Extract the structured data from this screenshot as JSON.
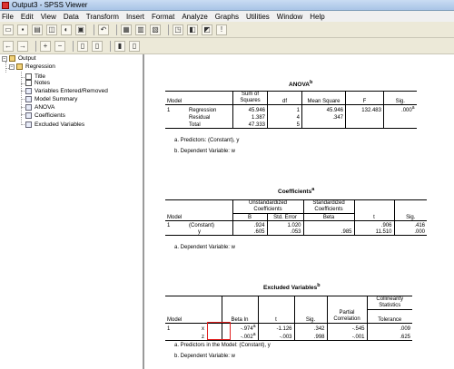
{
  "window": {
    "title": "Output3 - SPSS Viewer"
  },
  "menu": [
    "File",
    "Edit",
    "View",
    "Data",
    "Transform",
    "Insert",
    "Format",
    "Analyze",
    "Graphs",
    "Utilities",
    "Window",
    "Help"
  ],
  "toolbar": {
    "row1": [
      "open-icon",
      "save-icon",
      "print-icon",
      "print-preview-icon",
      "export-icon",
      "recall-dialog-icon",
      "undo-icon",
      "goto-data-icon",
      "goto-case-icon",
      "variables-icon",
      "use-sets-icon",
      "select-output-icon",
      "designate-window-icon",
      "help-icon"
    ],
    "row2": [
      "back-icon",
      "forward-icon",
      "promote-icon",
      "demote-icon",
      "expand-icon",
      "collapse-icon",
      "show-icon",
      "hide-icon"
    ]
  },
  "outline": {
    "root": "Output",
    "group": "Regression",
    "items": [
      "Title",
      "Notes",
      "Variables Entered/Removed",
      "Model Summary",
      "ANOVA",
      "Coefficients",
      "Excluded Variables"
    ]
  },
  "anova": {
    "title": "ANOVA",
    "title_sup": "b",
    "headers": [
      "Model",
      "Sum of Squares",
      "df",
      "Mean Square",
      "F",
      "Sig."
    ],
    "model": "1",
    "rows": [
      {
        "label": "Regression",
        "ss": "45.946",
        "df": "1",
        "ms": "45.946",
        "f": "132.483",
        "sig": ".000",
        "sig_sup": "a"
      },
      {
        "label": "Residual",
        "ss": "1.387",
        "df": "4",
        "ms": ".347",
        "f": "",
        "sig": ""
      },
      {
        "label": "Total",
        "ss": "47.333",
        "df": "5",
        "ms": "",
        "f": "",
        "sig": ""
      }
    ],
    "footnotes": [
      "a. Predictors: (Constant), y",
      "b. Dependent Variable: w"
    ]
  },
  "coefficients": {
    "title": "Coefficients",
    "title_sup": "a",
    "group_unstd": "Unstandardized Coefficients",
    "group_std": "Standardized Coefficients",
    "headers": [
      "Model",
      "B",
      "Std. Error",
      "Beta",
      "t",
      "Sig."
    ],
    "model": "1",
    "rows": [
      {
        "label": "(Constant)",
        "b": ".924",
        "se": "1.020",
        "beta": "",
        "t": ".906",
        "sig": ".416"
      },
      {
        "label": "y",
        "b": ".605",
        "se": ".053",
        "beta": ".985",
        "t": "11.510",
        "sig": ".000"
      }
    ],
    "footnotes": [
      "a. Dependent Variable: w"
    ]
  },
  "excluded": {
    "title": "Excluded Variables",
    "title_sup": "b",
    "group_collin": "Collinearity Statistics",
    "headers": [
      "Model",
      "Beta In",
      "t",
      "Sig.",
      "Partial Correlation",
      "Tolerance"
    ],
    "model": "1",
    "rows": [
      {
        "label": "x",
        "beta_in": "-.974",
        "beta_sup": "a",
        "t": "-1.126",
        "sig": ".342",
        "partial": "-.545",
        "tol": ".009"
      },
      {
        "label": "z",
        "beta_in": "-.002",
        "beta_sup": "a",
        "t": "-.003",
        "sig": ".998",
        "partial": "-.001",
        "tol": ".625"
      }
    ],
    "footnotes": [
      "a. Predictors in the Model: (Constant), y",
      "b. Dependent Variable: w"
    ]
  }
}
